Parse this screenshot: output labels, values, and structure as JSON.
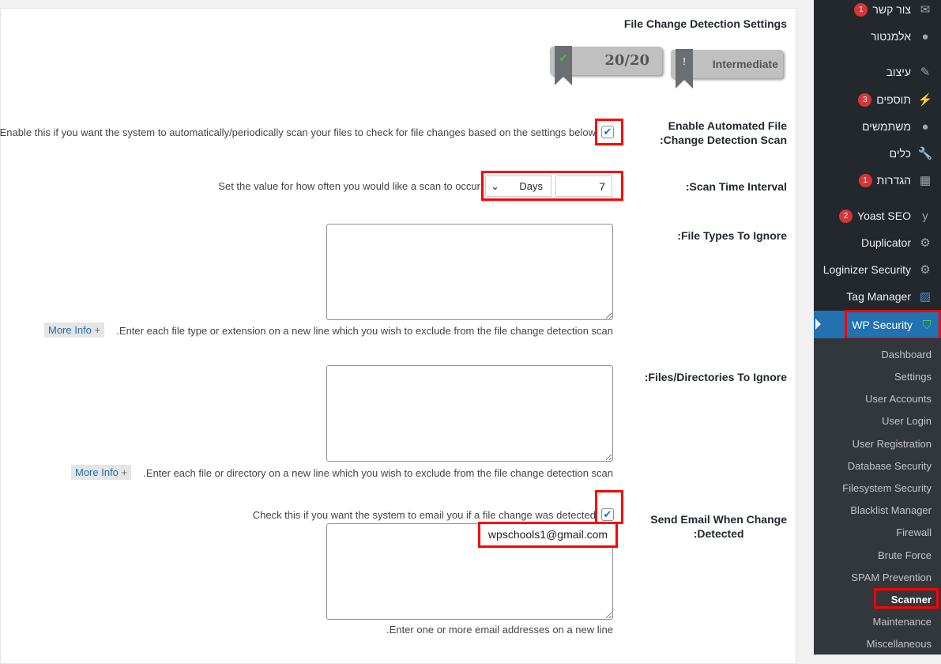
{
  "section_title": "File Change Detection Settings",
  "badges": {
    "score": "20/20",
    "level": "Intermediate"
  },
  "fields": {
    "enable_scan": {
      "label_1": "Enable Automated File",
      "label_2": ":Change Detection Scan",
      "desc": "Enable this if you want the system to automatically/periodically scan your files to check for file changes based on the settings below",
      "checked": true
    },
    "interval": {
      "label": ":Scan Time Interval",
      "desc": "Set the value for how often you would like a scan to occur",
      "value": "7",
      "unit": "Days"
    },
    "file_types": {
      "label": ":File Types To Ignore",
      "desc": ".Enter each file type or extension on a new line which you wish to exclude from the file change detection scan",
      "more": "More Info"
    },
    "files_dirs": {
      "label": ":Files/Directories To Ignore",
      "desc": ".Enter each file or directory on a new line which you wish to exclude from the file change detection scan",
      "more": "More Info"
    },
    "email": {
      "label_1": "Send Email When Change",
      "label_2": ":Detected",
      "desc": "Check this if you want the system to email you if a file change was detected",
      "checked": true,
      "value": "wpschools1@gmail.com",
      "hint": ".Enter one or more email addresses on a new line"
    }
  },
  "sidebar": {
    "items": [
      {
        "label": "צור קשר",
        "icon": "envelope-icon",
        "badge": "1"
      },
      {
        "label": "אלמנטור",
        "icon": "elementor-icon"
      },
      {
        "label": "עיצוב",
        "icon": "brush-icon"
      },
      {
        "label": "תוספים",
        "icon": "plugin-icon",
        "badge": "3"
      },
      {
        "label": "משתמשים",
        "icon": "user-icon"
      },
      {
        "label": "כלים",
        "icon": "wrench-icon"
      },
      {
        "label": "הגדרות",
        "icon": "settings-icon",
        "badge": "1"
      },
      {
        "label": "Yoast SEO",
        "icon": "yoast-icon",
        "badge": "2"
      },
      {
        "label": "Duplicator",
        "icon": "duplicator-icon"
      },
      {
        "label": "Loginizer Security",
        "icon": "gear-icon"
      },
      {
        "label": "Tag Manager",
        "icon": "tag-manager-icon"
      },
      {
        "label": "WP Security",
        "icon": "shield-icon"
      }
    ],
    "sub": [
      "Dashboard",
      "Settings",
      "User Accounts",
      "User Login",
      "User Registration",
      "Database Security",
      "Filesystem Security",
      "Blacklist Manager",
      "Firewall",
      "Brute Force",
      "SPAM Prevention",
      "Scanner",
      "Maintenance",
      "Miscellaneous"
    ],
    "active_color": "#2271b1"
  }
}
